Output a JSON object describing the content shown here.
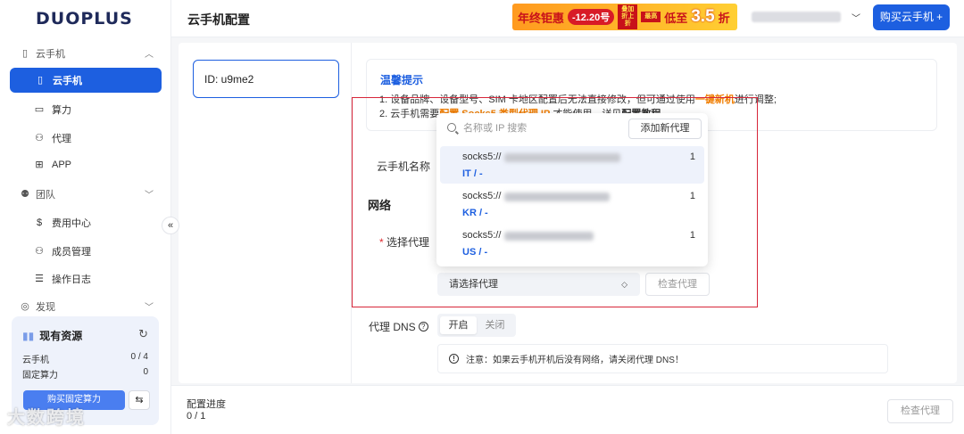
{
  "brand": {
    "logo": "DUOPLUS"
  },
  "header": {
    "title": "云手机配置",
    "buy_button": "购买云手机 +",
    "promo": {
      "part1": "年终钜惠",
      "tag": "-12.20号",
      "small1": "叠加折上折",
      "small2": "最高",
      "part2": "低至",
      "big": "3.5",
      "part3": "折"
    }
  },
  "sidebar": {
    "groups": [
      {
        "label": "云手机",
        "items": [
          "云手机",
          "算力",
          "代理",
          "APP"
        ]
      },
      {
        "label": "团队",
        "items": [
          "费用中心",
          "成员管理",
          "操作日志"
        ]
      },
      {
        "label": "发现",
        "items": []
      }
    ],
    "collapse_glyph": "«",
    "resources": {
      "title": "现有资源",
      "rows": [
        {
          "label": "云手机",
          "value": "0 / 4"
        },
        {
          "label": "固定算力",
          "value": "0"
        }
      ],
      "buy_fixed": "购买固定算力"
    },
    "watermark": "大数跨境"
  },
  "main": {
    "phone_id": "ID: u9me2",
    "tip": {
      "title": "温馨提示",
      "line1_pre": "1. 设备品牌、设备型号、SIM 卡地区配置后无法直接修改，但可通过使用",
      "line1_hl": "一键新机",
      "line1_post": "进行调整;",
      "line2_pre": "2. 云手机需要",
      "line2_hl": "配置 Socks5 类型代理 IP",
      "line2_mid": " 才能使用，详见",
      "line2_bold": "配置教程",
      "line2_post": "。"
    },
    "name_label": "云手机名称",
    "network_title": "网络",
    "proxy_label": "选择代理",
    "proxy_required_mark": "*",
    "proxy_select_placeholder": "请选择代理",
    "check_proxy": "检查代理",
    "dns": {
      "label": "代理 DNS",
      "help": "?",
      "options": [
        "开启",
        "关闭"
      ],
      "selected": "开启",
      "note": "注意：如果云手机开机后没有网络，请关闭代理 DNS！"
    },
    "dropdown": {
      "search_placeholder": "名称或 IP 搜索",
      "add_button": "添加新代理",
      "items": [
        {
          "proto": "socks5://",
          "region": "IT / -",
          "count": "1",
          "selected": true
        },
        {
          "proto": "socks5://",
          "region": "KR / -",
          "count": "1",
          "selected": false
        },
        {
          "proto": "socks5://",
          "region": "US / -",
          "count": "1",
          "selected": false
        }
      ]
    }
  },
  "bottom": {
    "progress_label": "配置进度",
    "progress_value": "0 / 1",
    "check_button": "检查代理"
  },
  "colors": {
    "primary": "#1d5fe0",
    "highlight": "#f07d00",
    "annotation_box": "#d7263a"
  }
}
